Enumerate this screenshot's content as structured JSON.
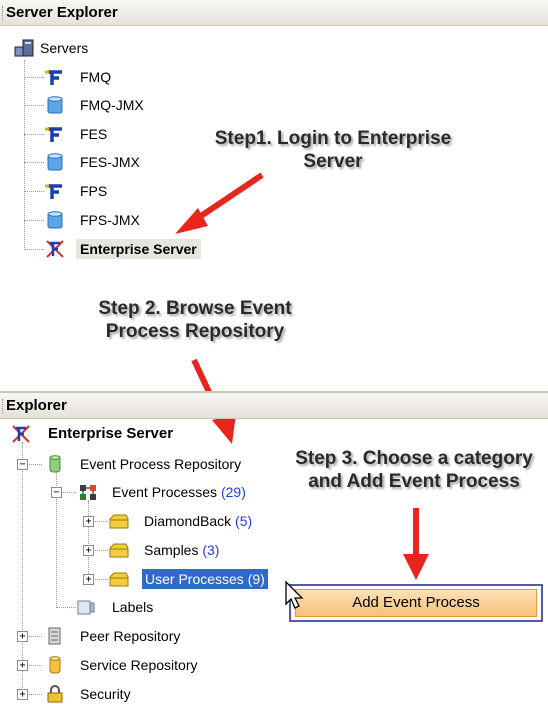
{
  "server_explorer": {
    "title": "Server Explorer",
    "root": "Servers",
    "items": [
      "FMQ",
      "FMQ-JMX",
      "FES",
      "FES-JMX",
      "FPS",
      "FPS-JMX",
      "Enterprise Server"
    ]
  },
  "explorer": {
    "title": "Explorer",
    "root": "Enterprise Server",
    "event_process_repository": "Event Process Repository",
    "event_processes": {
      "label": "Event Processes",
      "count": "(29)"
    },
    "categories": [
      {
        "label": "DiamondBack",
        "count": "(5)"
      },
      {
        "label": "Samples",
        "count": "(3)"
      },
      {
        "label": "User Processes",
        "count": "(9)"
      }
    ],
    "labels": "Labels",
    "peer_repository": "Peer Repository",
    "service_repository": "Service Repository",
    "security": "Security"
  },
  "context_menu": {
    "add_event_process": "Add Event Process"
  },
  "steps": {
    "step1": "Step1. Login to Enterprise Server",
    "step2": "Step 2. Browse Event Process Repository",
    "step3": "Step 3. Choose a category and Add Event Process"
  },
  "colors": {
    "selection": "#316ac5",
    "arrow": "#e8251c",
    "menu_highlight": "#f7c27a",
    "count": "#1f3fd1"
  }
}
